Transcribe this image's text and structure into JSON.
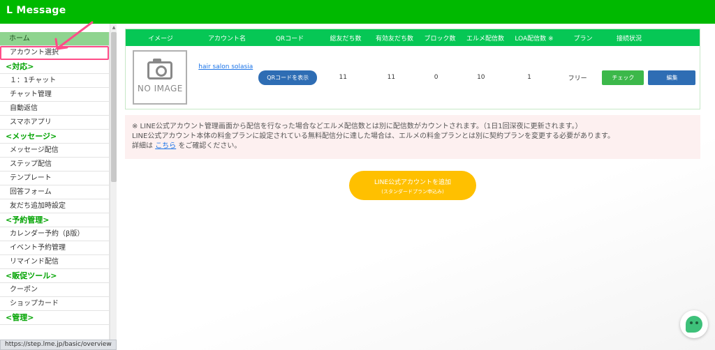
{
  "app": {
    "title": "L Message"
  },
  "sidebar": {
    "items": [
      {
        "label": "ホーム",
        "kind": "home"
      },
      {
        "label": "アカウント選択",
        "kind": "sub",
        "selected": true
      },
      {
        "label": "<対応>",
        "kind": "sec"
      },
      {
        "label": "１：1チャット",
        "kind": "sub"
      },
      {
        "label": "チャット管理",
        "kind": "sub"
      },
      {
        "label": "自動返信",
        "kind": "sub"
      },
      {
        "label": "スマホアプリ",
        "kind": "sub"
      },
      {
        "label": "<メッセージ>",
        "kind": "sec"
      },
      {
        "label": "メッセージ配信",
        "kind": "sub"
      },
      {
        "label": "ステップ配信",
        "kind": "sub"
      },
      {
        "label": "テンプレート",
        "kind": "sub"
      },
      {
        "label": "回答フォーム",
        "kind": "sub"
      },
      {
        "label": "友だち追加時設定",
        "kind": "sub"
      },
      {
        "label": "<予約管理>",
        "kind": "sec"
      },
      {
        "label": "カレンダー予約（β版）",
        "kind": "sub"
      },
      {
        "label": "イベント予約管理",
        "kind": "sub"
      },
      {
        "label": "リマインド配信",
        "kind": "sub"
      },
      {
        "label": "<販促ツール>",
        "kind": "sec"
      },
      {
        "label": "クーポン",
        "kind": "sub"
      },
      {
        "label": "ショップカード",
        "kind": "sub"
      },
      {
        "label": "<管理>",
        "kind": "sec"
      }
    ]
  },
  "table": {
    "headers": [
      "イメージ",
      "アカウント名",
      "QRコード",
      "総友だち数",
      "有効友だち数",
      "ブロック数",
      "エルメ配信数",
      "LOA配信数 ※",
      "プラン",
      "接続状況",
      ""
    ],
    "row": {
      "image_text": "NO IMAGE",
      "account_name": "hair salon solasia",
      "qr_button": "QRコードを表示",
      "total_friends": "11",
      "valid_friends": "11",
      "blocks": "0",
      "lme_sends": "10",
      "loa_sends": "1",
      "plan": "フリー",
      "check_button": "チェック",
      "edit_button": "編集"
    }
  },
  "notice": {
    "line1": "※ LINE公式アカウント管理画面から配信を行なった場合などエルメ配信数とは別に配信数がカウントされます。（1日1回深夜に更新されます。）",
    "line2": "LINE公式アカウント本体の料金プランに設定されている無料配信分に達した場合は、エルメの料金プランとは別に契約プランを変更する必要があります。",
    "line3_pre": "詳細は",
    "link": "こちら",
    "line3_post": "をご確認ください。"
  },
  "add_account": {
    "line1": "LINE公式アカウントを追加",
    "line2": "(スタンダードプラン申込み)"
  },
  "status_url": "https://step.lme.jp/basic/overview",
  "colors": {
    "brand": "#00b900",
    "header_green": "#06c755",
    "highlight": "#ff4d88",
    "button_blue": "#2e6db4",
    "yellow": "#ffc000"
  }
}
